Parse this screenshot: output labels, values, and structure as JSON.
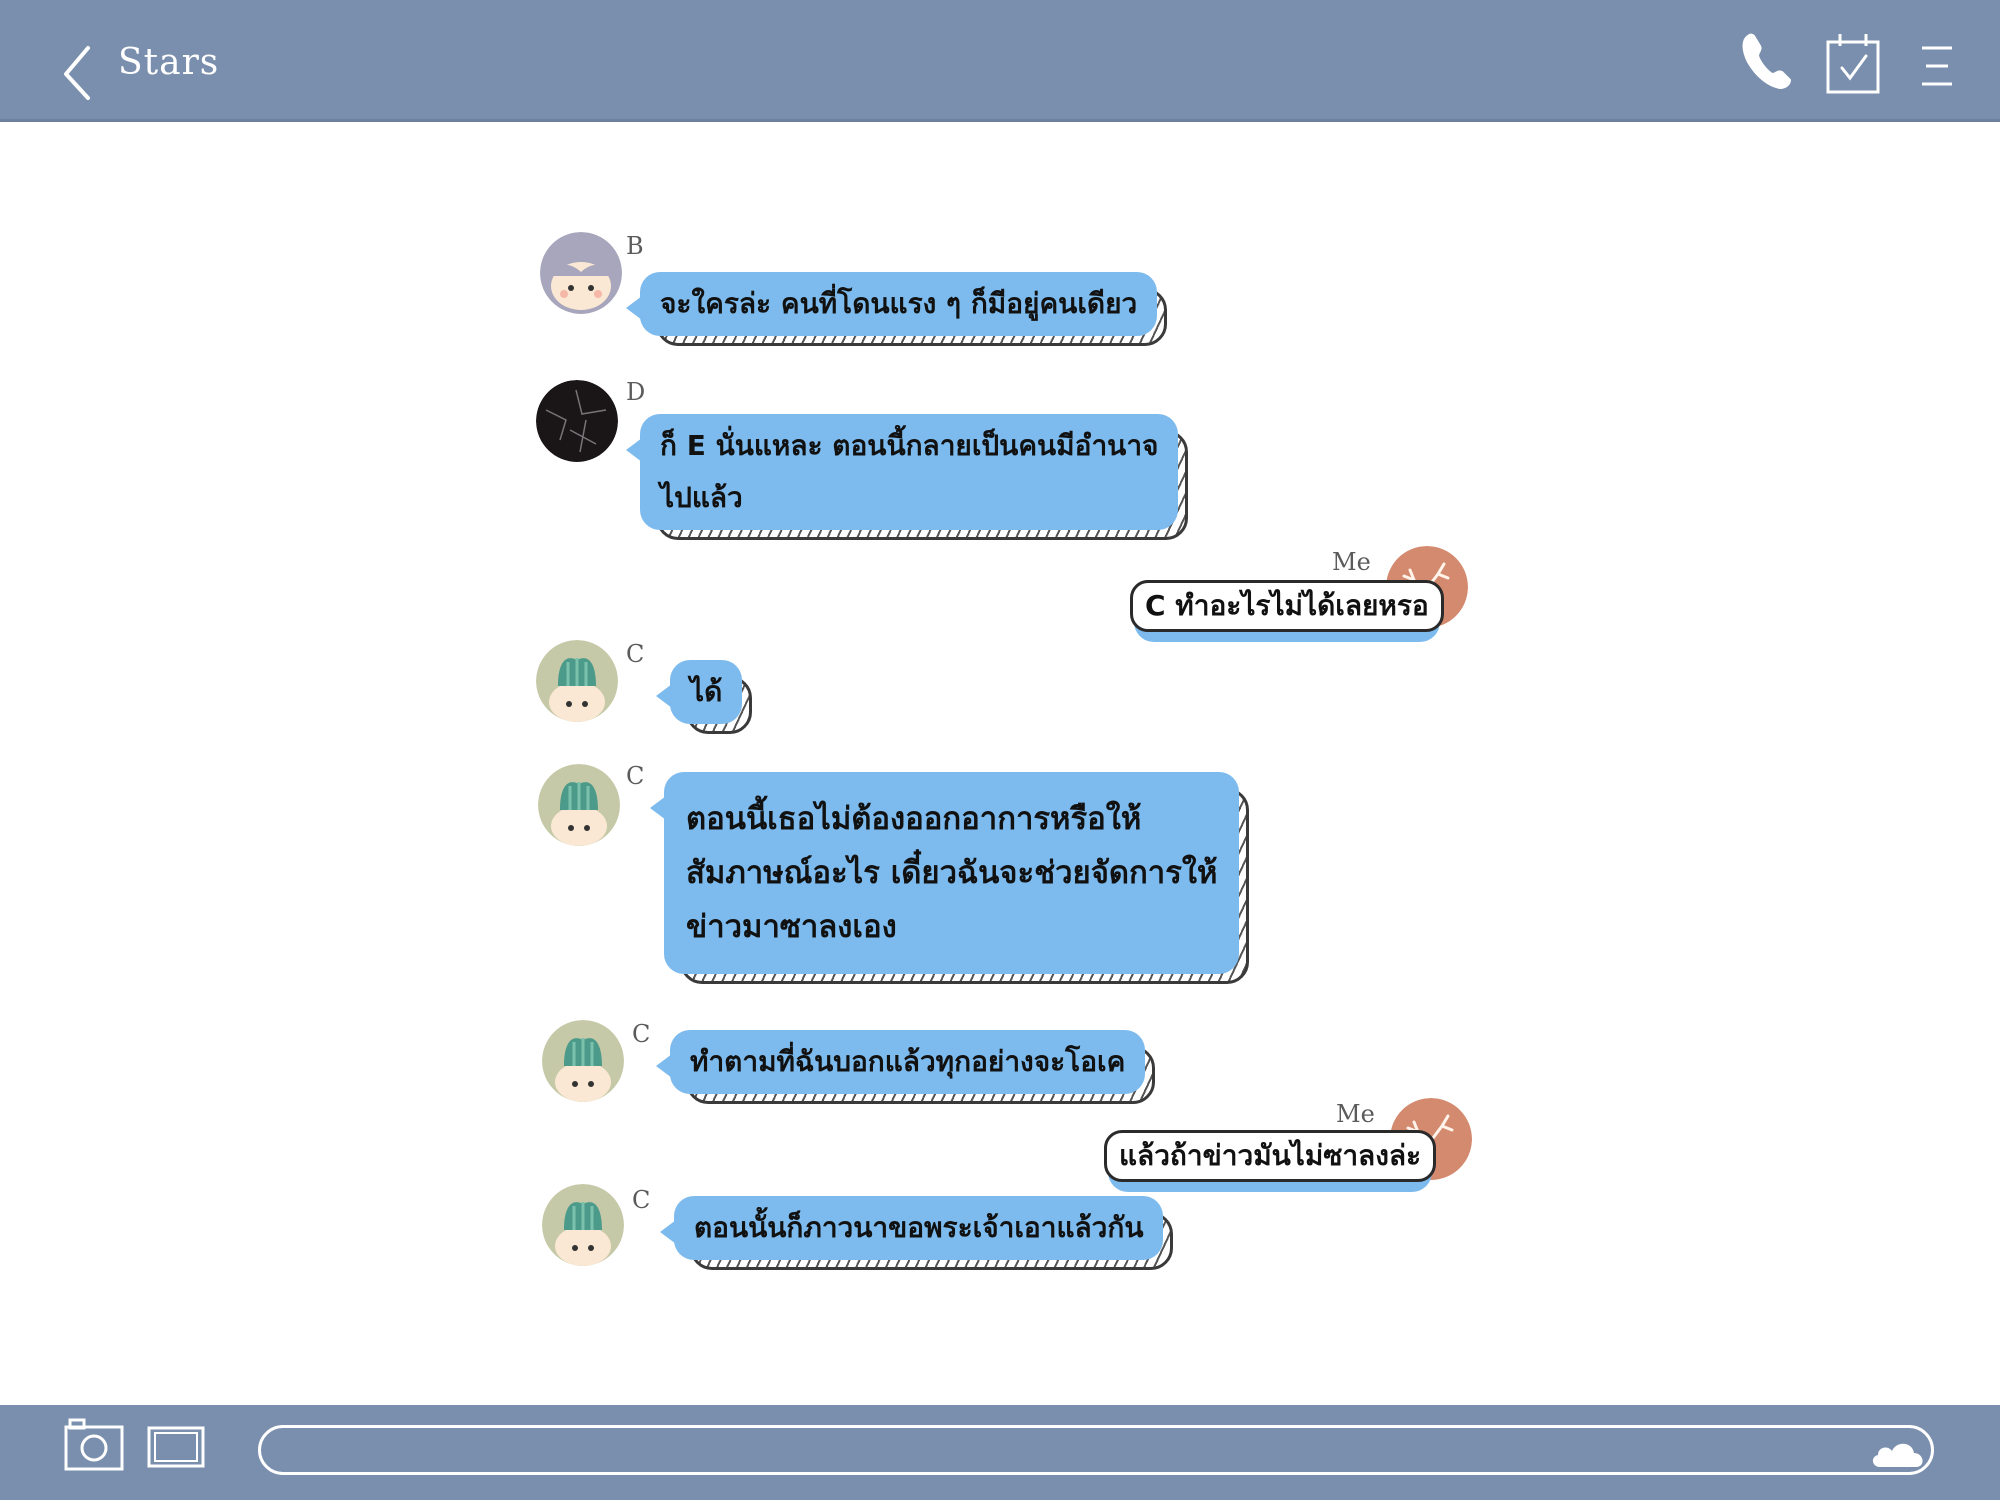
{
  "header": {
    "title": "Stars",
    "back_icon": "chevron-left-icon",
    "call_icon": "phone-icon",
    "todo_icon": "checklist-icon",
    "menu_icon": "hamburger-menu-icon"
  },
  "colors": {
    "bar": "#7a8fad",
    "bubble": "#7dbbee",
    "avatar_me": "#d48a6e"
  },
  "messages": [
    {
      "sender": "B",
      "text": "จะใครล่ะ คนที่โดนแรง ๆ ก็มีอยู่คนเดียว"
    },
    {
      "sender": "D",
      "line1": "ก็ E นั่นแหละ ตอนนี้กลายเป็นคนมีอำนาจ",
      "line2": "ไปแล้ว"
    },
    {
      "sender": "Me",
      "text": "C ทำอะไรไม่ได้เลยหรอ"
    },
    {
      "sender": "C",
      "text": "ได้"
    },
    {
      "sender": "C",
      "line1": "ตอนนี้เธอไม่ต้องออกอาการหรือให้",
      "line2": "สัมภาษณ์อะไร เดี๋ยวฉันจะช่วยจัดการให้",
      "line3": "ข่าวมาซาลงเอง"
    },
    {
      "sender": "C",
      "text": "ทำตามที่ฉันบอกแล้วทุกอย่างจะโอเค"
    },
    {
      "sender": "Me",
      "text": "แล้วถ้าข่าวมันไม่ซาลงล่ะ"
    },
    {
      "sender": "C",
      "text": "ตอนนั้นก็ภาวนาขอพระเจ้าเอาแล้วกัน"
    }
  ],
  "footer": {
    "camera_icon": "camera-icon",
    "image_icon": "image-icon",
    "send_icon": "cloud-send-icon",
    "input_value": ""
  }
}
